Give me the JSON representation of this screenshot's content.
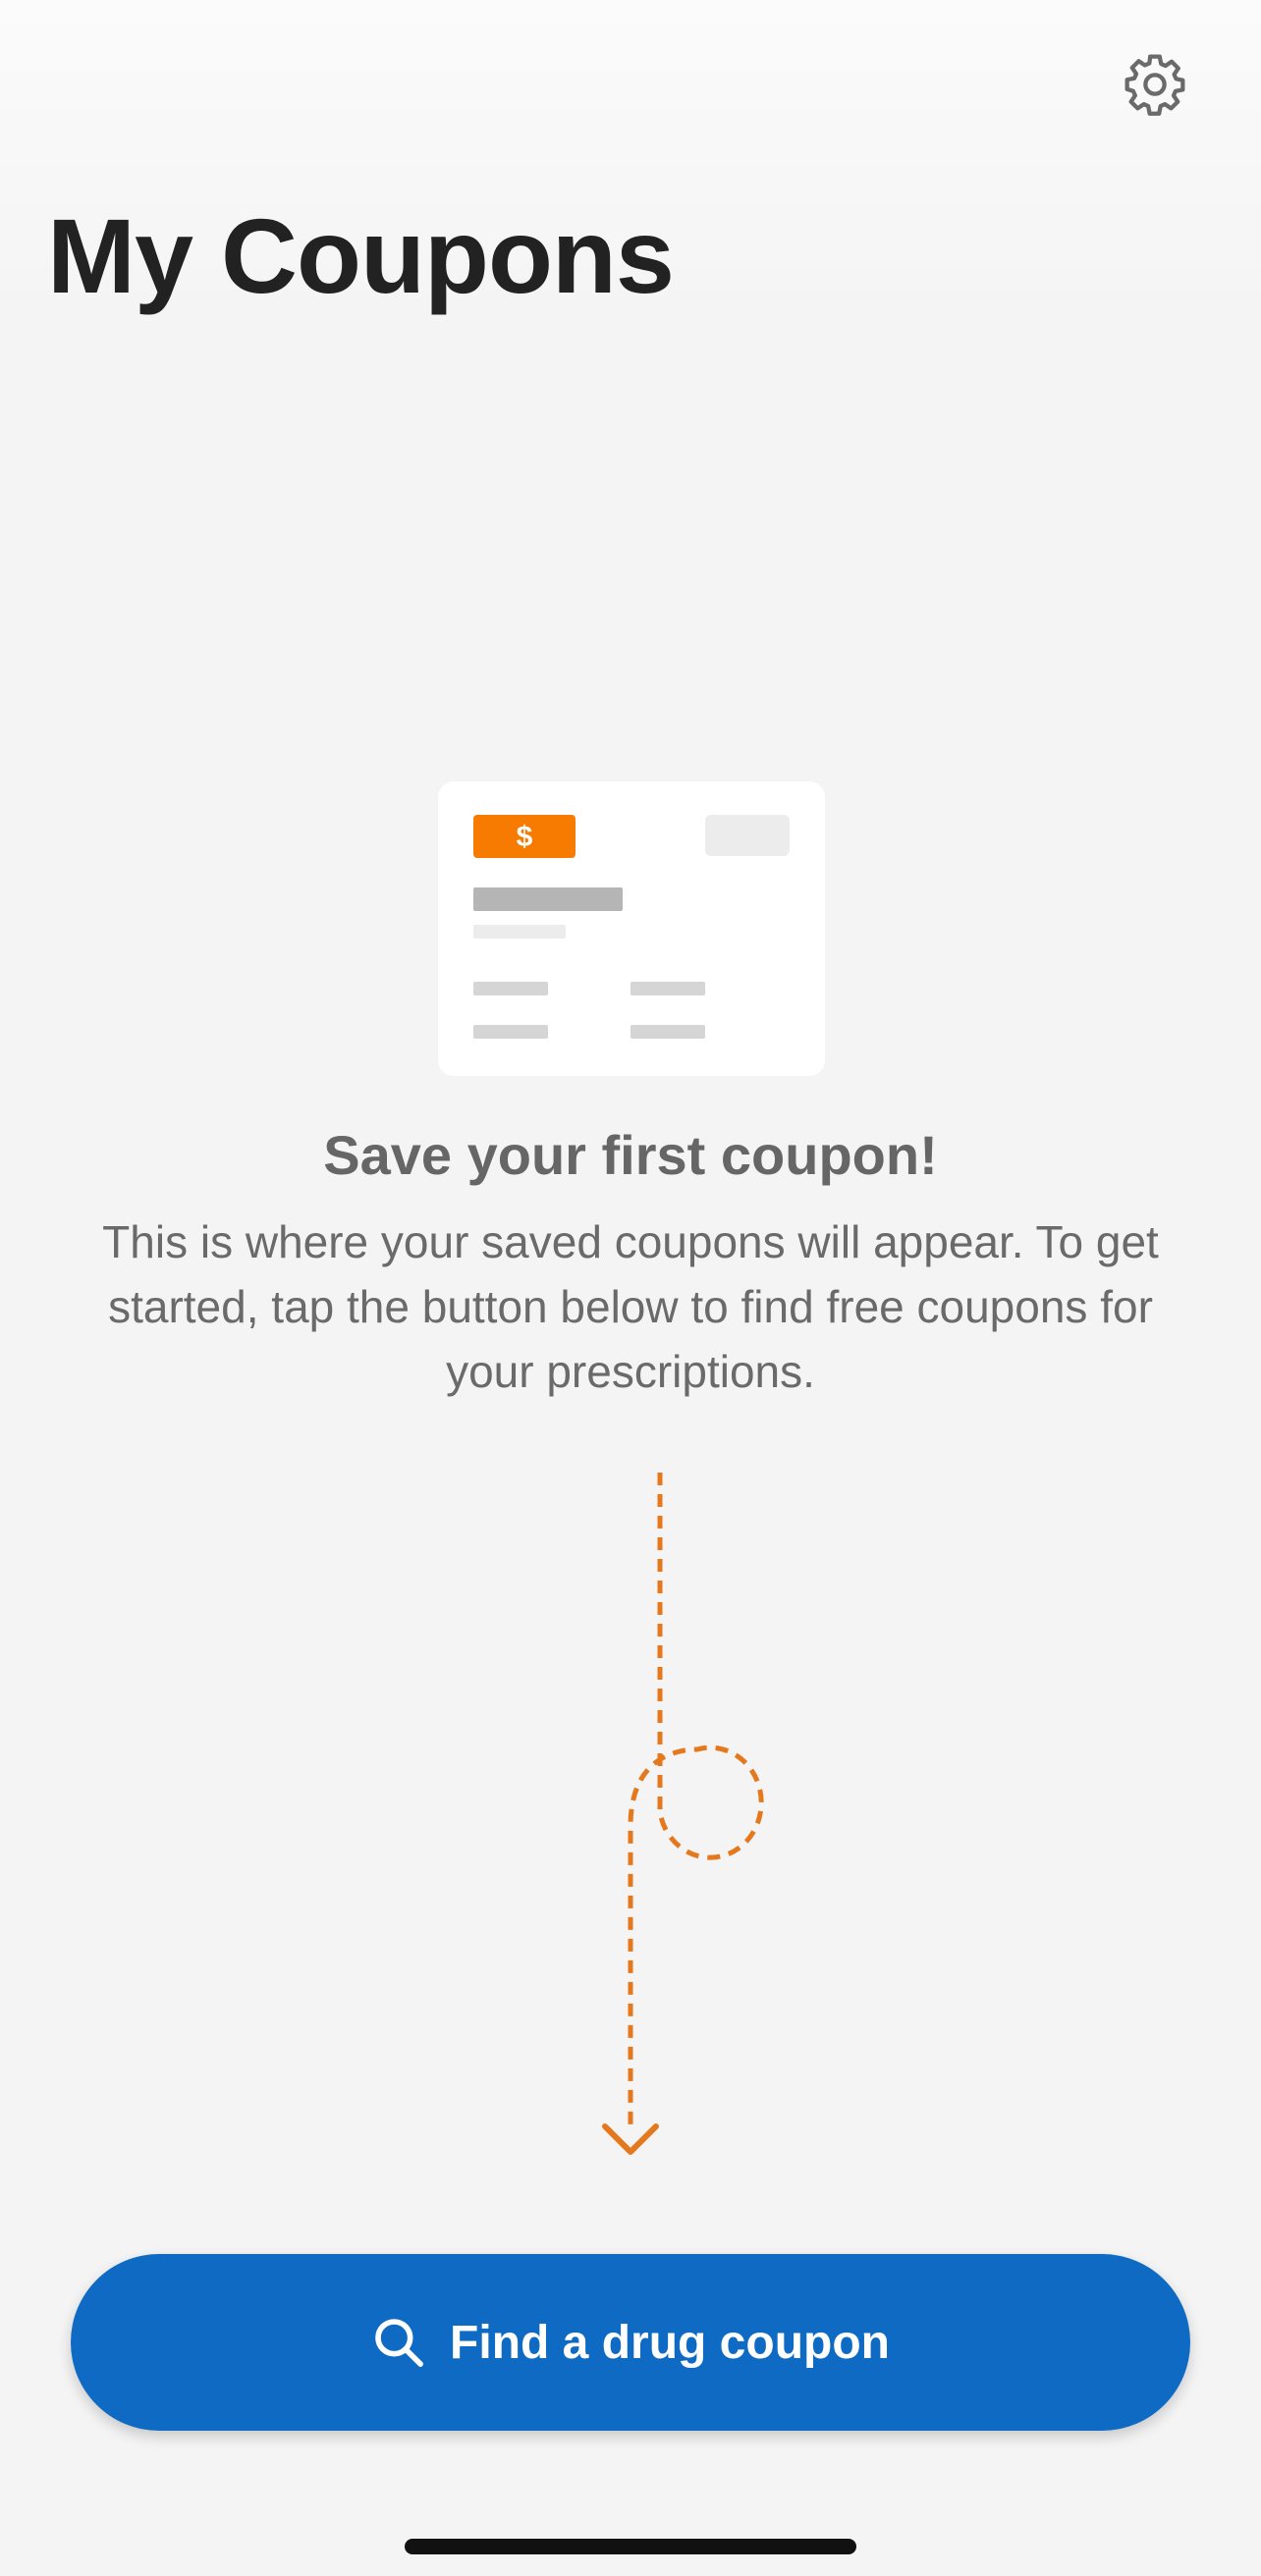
{
  "header": {
    "title": "My Coupons",
    "settings_icon": "gear-icon"
  },
  "empty_state": {
    "illustration": {
      "badge_symbol": "$",
      "badge_color": "#f77b00"
    },
    "title": "Save your first coupon!",
    "description": "This is where your saved coupons will appear. To get started, tap the button below to find free coupons for your prescriptions.",
    "arrow_color": "#e5781d"
  },
  "cta": {
    "icon": "search-icon",
    "label": "Find a drug coupon",
    "color": "#0e6ac3"
  }
}
